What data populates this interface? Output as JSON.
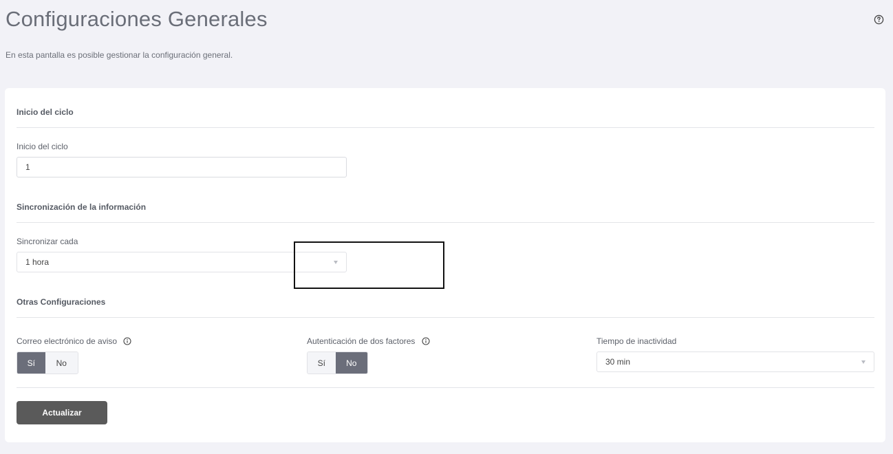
{
  "header": {
    "title": "Configuraciones Generales",
    "description": "En esta pantalla es posible gestionar la configuración general.",
    "help_icon": "question-circle-icon"
  },
  "sections": {
    "cycle": {
      "title": "Inicio del ciclo",
      "field_label": "Inicio del ciclo",
      "field_value": "1"
    },
    "sync": {
      "title": "Sincronización de la información",
      "field_label": "Sincronizar cada",
      "selected": "1 hora"
    },
    "other": {
      "title": "Otras Configuraciones",
      "email_label": "Correo electrónico de aviso",
      "email_options": [
        "Sí",
        "No"
      ],
      "email_selected": "Sí",
      "twofa_label": "Autenticación de dos factores",
      "twofa_options": [
        "Sí",
        "No"
      ],
      "twofa_selected": "No",
      "inactivity_label": "Tiempo de inactividad",
      "inactivity_selected": "30 min"
    }
  },
  "actions": {
    "update_label": "Actualizar"
  },
  "colors": {
    "background": "#f2f2f7",
    "toggle_active": "#6b6e7a",
    "button": "#5a5a5a",
    "highlight_border": "#111111"
  }
}
